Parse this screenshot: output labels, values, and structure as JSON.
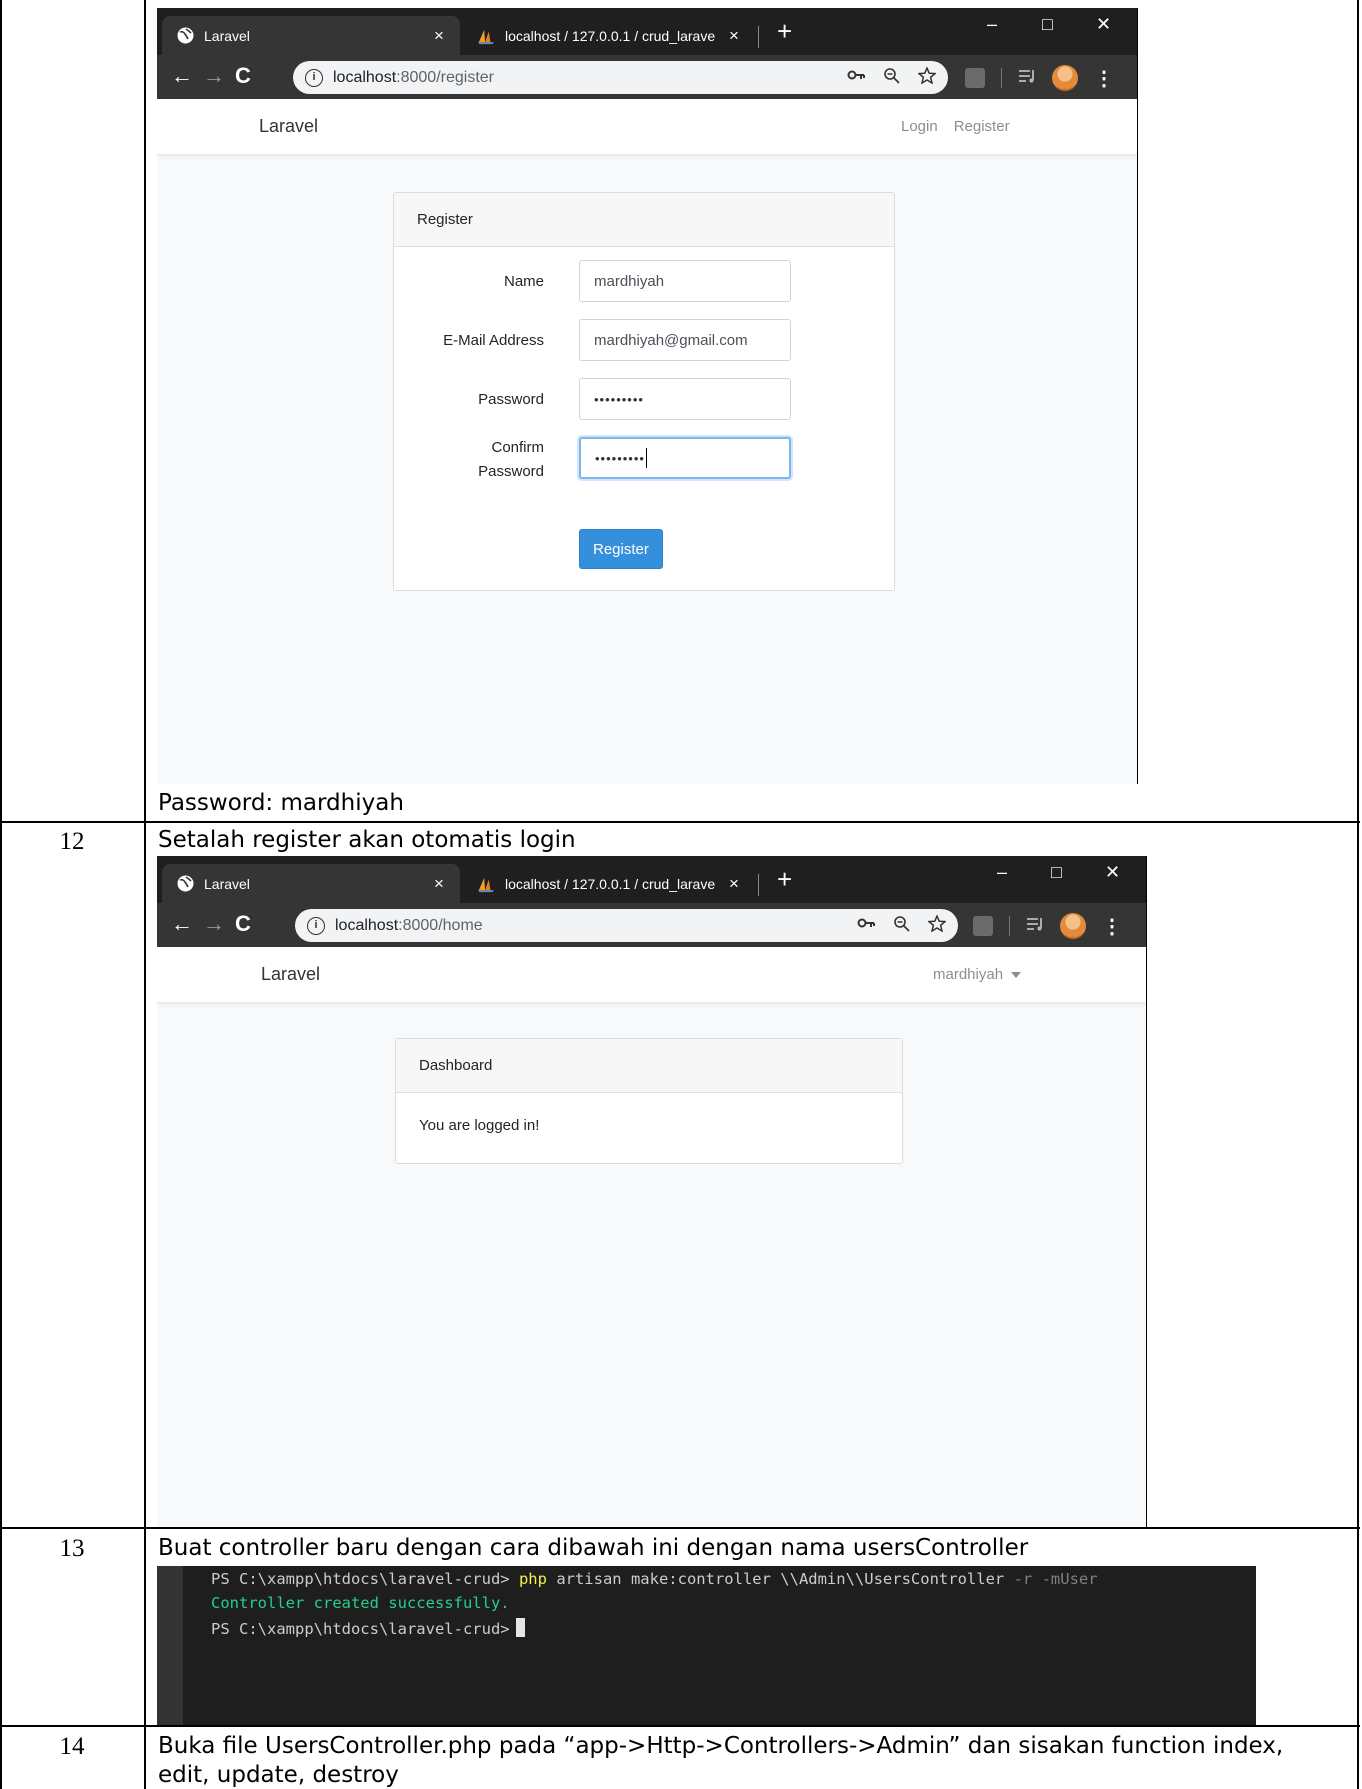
{
  "rows": {
    "caption_11": "Password: mardhiyah",
    "row_12": {
      "number": "12",
      "text": "Setalah register akan otomatis login"
    },
    "row_13": {
      "number": "13",
      "text": "Buat controller baru dengan cara dibawah ini dengan nama usersController"
    },
    "row_14": {
      "number": "14",
      "text_line1": "Buka file UsersController.php pada “app->Http->Controllers->Admin” dan sisakan function index,",
      "text_line2": "edit, update, destroy"
    }
  },
  "browser": {
    "tab1_title": "Laravel",
    "tab2_title": "localhost / 127.0.0.1 / crud_larave",
    "tab_close": "×",
    "new_tab": "+",
    "min": "–",
    "max": "□",
    "close": "✕",
    "back": "←",
    "forward": "→",
    "reload": "C",
    "info_icon": "i",
    "url_host": "localhost",
    "menu": "⋮",
    "brand": "Laravel"
  },
  "register_shot": {
    "url_path": ":8000/register",
    "nav_links": [
      "Login",
      "Register"
    ],
    "card_title": "Register",
    "labels": {
      "name": "Name",
      "email": "E-Mail Address",
      "password": "Password",
      "confirm_line1": "Confirm",
      "confirm_line2": "Password"
    },
    "values": {
      "name": "mardhiyah",
      "email": "mardhiyah@gmail.com",
      "password": "•••••••••",
      "confirm": "•••••••••"
    },
    "submit_label": "Register"
  },
  "home_shot": {
    "url_path": ":8000/home",
    "user_menu": "mardhiyah",
    "card_title": "Dashboard",
    "card_body": "You are logged in!"
  },
  "terminal": {
    "prompt": "PS C:\\xampp\\htdocs\\laravel-crud>",
    "cmd_keyword": "php",
    "cmd_rest": "artisan make:controller \\\\Admin\\\\UsersController",
    "cmd_flags": "-r -mUser",
    "success": "Controller created successfully."
  },
  "colors": {
    "primary": "#3490dc",
    "chrome_dark": "#1f1f1f",
    "terminal_bg": "#1e1e1e",
    "terminal_green": "#23d18b",
    "terminal_yellow": "#f5f543"
  }
}
